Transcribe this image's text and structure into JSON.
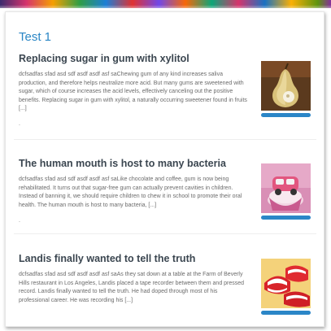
{
  "page": {
    "title": "Test 1"
  },
  "posts": [
    {
      "title": "Replacing sugar in gum with xylitol",
      "excerpt": "dcfsadfas sfad asd sdf asdf asdf asf saChewing gum of any kind increases saliva production, and therefore helps neutralize more acid. But many gums are sweetened with sugar, which of course increases the acid levels, effectively canceling out the positive benefits. Replacing sugar in gum with xylitol, a naturally occurring sweetener found in fruits [...]",
      "trailing": ".",
      "thumbnail_icon": "pear-photo"
    },
    {
      "title": "The human mouth is host to many bacteria",
      "excerpt": "dcfsadfas sfad asd sdf asdf asdf asf saLike chocolate and coffee, gum is now being rehabilitated. It turns out that sugar-free gum can actually prevent cavities in children. Instead of banning it, we should require children to chew it in school to promote their oral health. The human mouth is host to many bacteria, [...]",
      "trailing": ".",
      "thumbnail_icon": "cupcake-photo"
    },
    {
      "title": "Landis finally wanted to tell the truth",
      "excerpt": "dcfsadfas sfad asd sdf asdf asdf asf saAs they sat down at a table at the Farm of Beverly Hills restaurant in Los Angeles, Landis placed a tape recorder between them and pressed record. Landis finally wanted to tell the truth. He had doped through most of his professional career. He was recording his [...]",
      "trailing": "",
      "thumbnail_icon": "wind-up-teeth-photo"
    }
  ],
  "colors": {
    "accent": "#2a86c5",
    "title_text": "#3b4650",
    "body_text": "#6b6b6b",
    "thumb_bar": "#2b86c7"
  }
}
